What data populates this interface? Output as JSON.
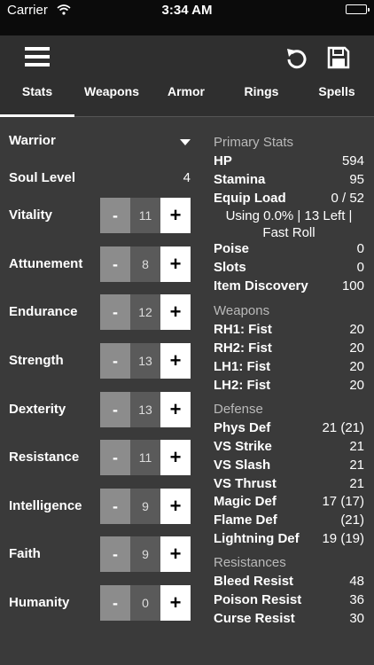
{
  "statusbar": {
    "carrier": "Carrier",
    "time": "3:34 AM"
  },
  "tabs": [
    {
      "label": "Stats",
      "icon": "menu-icon"
    },
    {
      "label": "Weapons"
    },
    {
      "label": "Armor"
    },
    {
      "label": "Rings",
      "icon": "refresh-icon"
    },
    {
      "label": "Spells",
      "icon": "save-icon"
    }
  ],
  "left": {
    "class_value": "Warrior",
    "soul_level_label": "Soul Level",
    "soul_level_value": "4",
    "stepper_minus": "-",
    "stepper_plus": "+",
    "stats": [
      {
        "name": "Vitality",
        "value": "11"
      },
      {
        "name": "Attunement",
        "value": "8"
      },
      {
        "name": "Endurance",
        "value": "12"
      },
      {
        "name": "Strength",
        "value": "13"
      },
      {
        "name": "Dexterity",
        "value": "13"
      },
      {
        "name": "Resistance",
        "value": "11"
      },
      {
        "name": "Intelligence",
        "value": "9"
      },
      {
        "name": "Faith",
        "value": "9"
      },
      {
        "name": "Humanity",
        "value": "0"
      }
    ]
  },
  "right": {
    "primary": {
      "title": "Primary Stats",
      "hp_label": "HP",
      "hp_value": "594",
      "stamina_label": "Stamina",
      "stamina_value": "95",
      "equip_label": "Equip Load",
      "equip_value": "0 / 52",
      "equip_line1": "Using 0.0% | 13 Left |",
      "equip_line2": "Fast Roll",
      "poise_label": "Poise",
      "poise_value": "0",
      "slots_label": "Slots",
      "slots_value": "0",
      "item_label": "Item Discovery",
      "item_value": "100"
    },
    "weapons": {
      "title": "Weapons",
      "rows": [
        {
          "k": "RH1: Fist",
          "v": "20"
        },
        {
          "k": "RH2: Fist",
          "v": "20"
        },
        {
          "k": "LH1: Fist",
          "v": "20"
        },
        {
          "k": "LH2: Fist",
          "v": "20"
        }
      ]
    },
    "defense": {
      "title": "Defense",
      "rows": [
        {
          "k": "Phys Def",
          "v": "21 (21)"
        },
        {
          "k": "VS Strike",
          "v": "21"
        },
        {
          "k": "VS Slash",
          "v": "21"
        },
        {
          "k": "VS Thrust",
          "v": "21"
        },
        {
          "k": "Magic Def",
          "v": "17 (17)"
        },
        {
          "k": "Flame Def",
          "v": "(21)"
        },
        {
          "k": "Lightning Def",
          "v": "19 (19)"
        }
      ]
    },
    "resist": {
      "title": "Resistances",
      "rows": [
        {
          "k": "Bleed Resist",
          "v": "48"
        },
        {
          "k": "Poison Resist",
          "v": "36"
        },
        {
          "k": "Curse Resist",
          "v": "30"
        }
      ]
    }
  }
}
